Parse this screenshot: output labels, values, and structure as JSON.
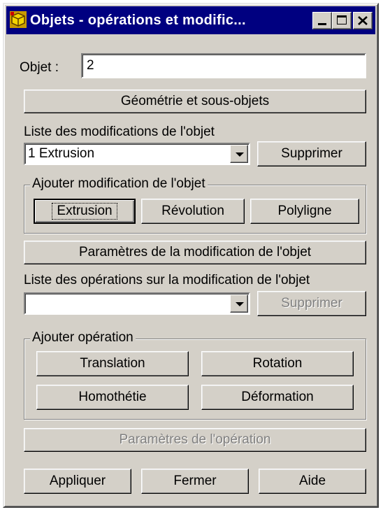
{
  "window": {
    "title": "Objets - opérations et modific...",
    "controls": [
      "minimize-icon",
      "maximize-icon",
      "close-icon"
    ]
  },
  "objet": {
    "label": "Objet :",
    "value": "2"
  },
  "geometry_button": "Géométrie et sous-objets",
  "modifications": {
    "label": "Liste des modifications de l'objet",
    "selected": "1 Extrusion",
    "delete_label": "Supprimer"
  },
  "add_modification": {
    "legend": "Ajouter modification de l'objet",
    "buttons": [
      "Extrusion",
      "Révolution",
      "Polyligne"
    ]
  },
  "modification_params_button": "Paramètres de la modification de l'objet",
  "operations": {
    "label": "Liste des opérations sur la modification de l'objet",
    "selected": "",
    "delete_label": "Supprimer"
  },
  "add_operation": {
    "legend": "Ajouter opération",
    "buttons": [
      "Translation",
      "Rotation",
      "Homothétie",
      "Déformation"
    ]
  },
  "operation_params_button": "Paramètres de l'opération",
  "footer": {
    "apply": "Appliquer",
    "close": "Fermer",
    "help": "Aide"
  }
}
